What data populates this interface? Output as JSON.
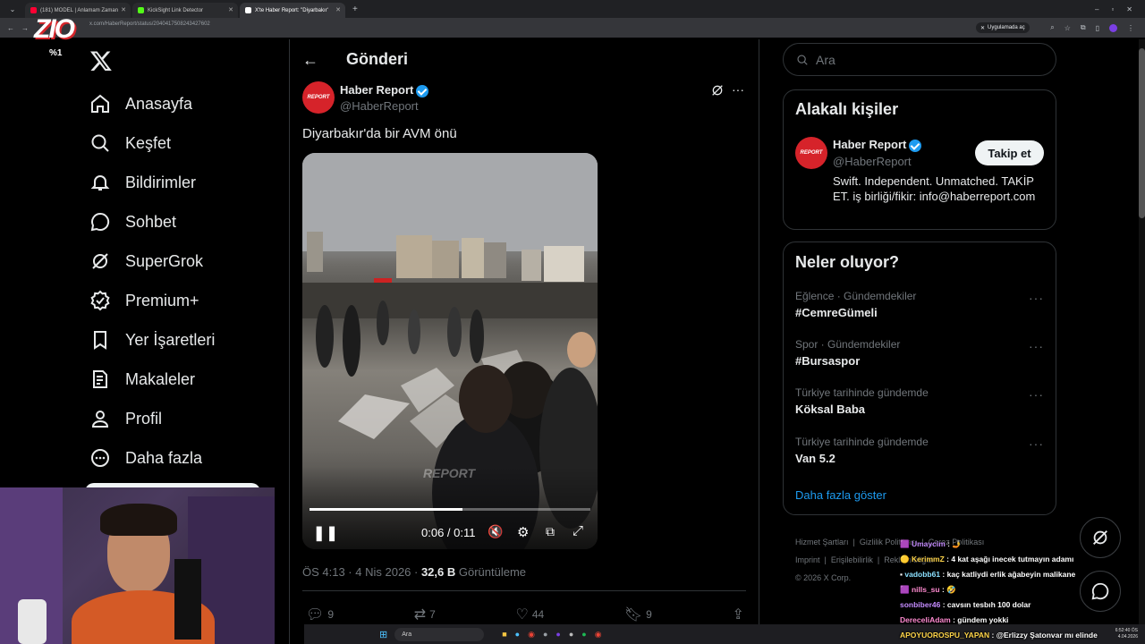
{
  "browser": {
    "tabs": [
      {
        "label": "(181) MODEL | Anlamam Zaman",
        "color": "#ff0033"
      },
      {
        "label": "KickSight Link Detector",
        "color": "#53fc18"
      },
      {
        "label": "X'te Haber Report: \"Diyarbakır'",
        "color": "#ffffff"
      }
    ],
    "url": "x.com/HaberReport/status/2040417508243427602",
    "install_pill": "Uygulamada aç"
  },
  "overlay": {
    "logo": "ZIO",
    "percent": "%1"
  },
  "nav": {
    "items": [
      {
        "label": "Anasayfa",
        "icon": "home-icon"
      },
      {
        "label": "Keşfet",
        "icon": "search-icon"
      },
      {
        "label": "Bildirimler",
        "icon": "bell-icon"
      },
      {
        "label": "Sohbet",
        "icon": "chat-icon"
      },
      {
        "label": "SuperGrok",
        "icon": "grok-icon"
      },
      {
        "label": "Premium+",
        "icon": "premium-icon"
      },
      {
        "label": "Yer İşaretleri",
        "icon": "bookmark-icon"
      },
      {
        "label": "Makaleler",
        "icon": "article-icon"
      },
      {
        "label": "Profil",
        "icon": "person-icon"
      },
      {
        "label": "Daha fazla",
        "icon": "more-circle-icon"
      }
    ]
  },
  "post": {
    "header": "Gönderi",
    "author_name": "Haber Report",
    "author_handle": "@HaberReport",
    "avatar_text": "REPORT",
    "text": "Diyarbakır'da bir AVM önü",
    "video": {
      "time": "0:06 / 0:11",
      "progress": 0.545,
      "watermark": "REPORT"
    },
    "time": "ÖS 4:13 · 4 Nis 2026 · ",
    "views_count": "32,6 B",
    "views_label": " Görüntüleme",
    "actions": {
      "replies": "9",
      "reposts": "7",
      "likes": "44",
      "bookmarks": "9"
    }
  },
  "sidebar": {
    "search_placeholder": "Ara",
    "related": {
      "title": "Alakalı kişiler",
      "name": "Haber Report",
      "handle": "@HaberReport",
      "follow_label": "Takip et",
      "bio": "Swift. Independent. Unmatched. TAKİP ET. iş birliği/fikir: info@haberreport.com"
    },
    "trends": {
      "title": "Neler oluyor?",
      "items": [
        {
          "category": "Eğlence · Gündemdekiler",
          "name": "#CemreGümeli"
        },
        {
          "category": "Spor · Gündemdekiler",
          "name": "#Bursaspor"
        },
        {
          "category": "Türkiye tarihinde gündemde",
          "name": "Köksal Baba"
        },
        {
          "category": "Türkiye tarihinde gündemde",
          "name": "Van 5.2"
        }
      ],
      "show_more": "Daha fazla göster"
    },
    "footer": {
      "links": [
        "Hizmet Şartları",
        "Gizlilik Politikası",
        "Çerez Politikası",
        "Imprint",
        "Erişilebilirlik",
        "Reklam bilgisi"
      ],
      "copyright": "© 2026 X Corp."
    }
  },
  "chat": [
    {
      "user": "Umaycim",
      "msg": " : 🤳",
      "color": "#c58cff"
    },
    {
      "user": "KerimmZ",
      "msg": " : 4 kat aşağı inecek tutmayın adamı",
      "color": "#ffd54a"
    },
    {
      "user": "vadobb61",
      "msg": " : kaç katliydi erlik ağabeyin malikane",
      "color": "#8be0ff"
    },
    {
      "user": "nills_su",
      "msg": " : 🤣",
      "color": "#ff8ad0"
    },
    {
      "user": "sonbiber46",
      "msg": " : cavsın tesbıh 100 dolar",
      "color": "#c58cff"
    },
    {
      "user": "DereceliAdam",
      "msg": " : gündem yokki",
      "color": "#ff8ad0"
    },
    {
      "user": "APOYUOROSPU_YAPAN",
      "msg": " : @Erlizzy Şatonvar mı elinde",
      "color": "#ffd54a"
    }
  ],
  "taskbar": {
    "search": "Ara",
    "clock_time": "6:52:40 ÖS",
    "clock_date": "4.04.2026"
  }
}
